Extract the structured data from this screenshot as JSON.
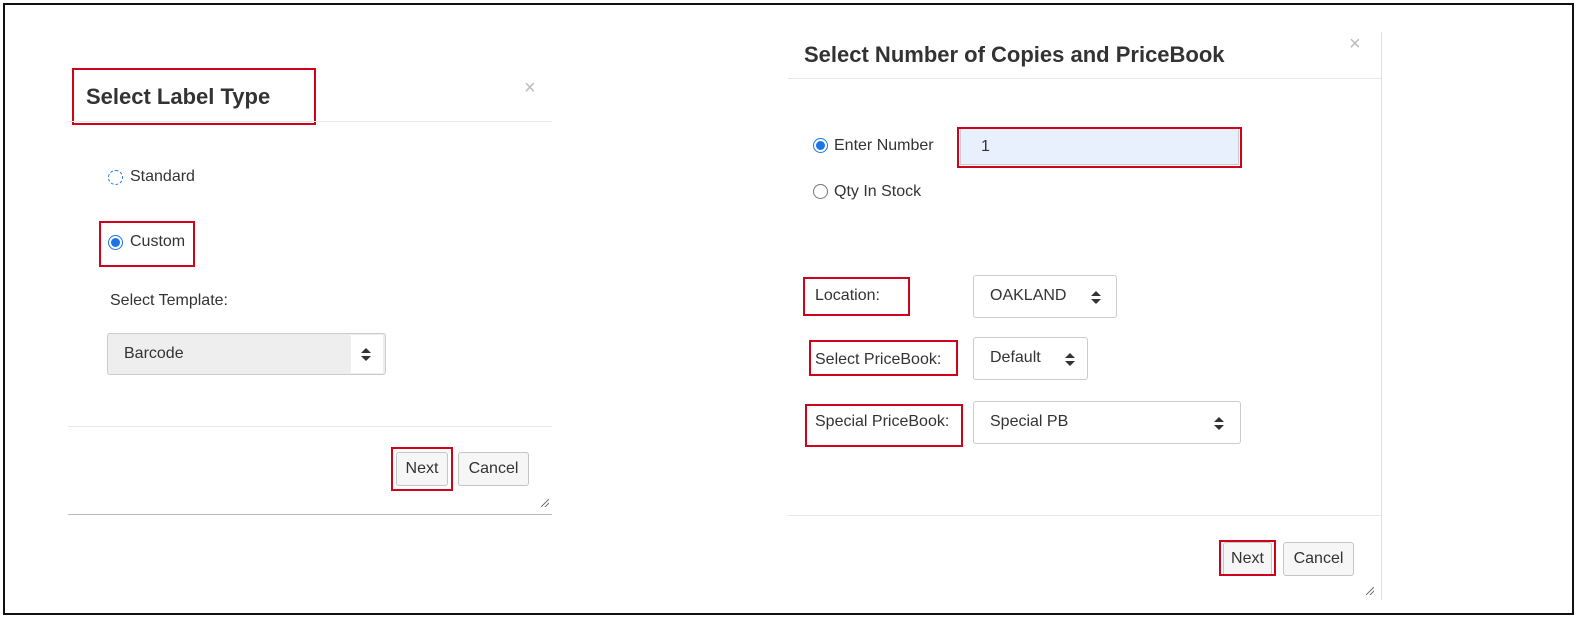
{
  "left_dialog": {
    "title": "Select Label Type",
    "close_glyph": "×",
    "options": [
      {
        "label": "Standard",
        "selected": false
      },
      {
        "label": "Custom",
        "selected": true
      }
    ],
    "template_label": "Select Template:",
    "template_value": "Barcode",
    "next_label": "Next",
    "cancel_label": "Cancel"
  },
  "right_dialog": {
    "title": "Select Number of Copies and PriceBook",
    "close_glyph": "×",
    "options": [
      {
        "label": "Enter Number",
        "selected": true
      },
      {
        "label": "Qty In Stock",
        "selected": false
      }
    ],
    "number_value": "1",
    "location_label": "Location:",
    "location_value": "OAKLAND",
    "pricebook_label": "Select PriceBook:",
    "pricebook_value": "Default",
    "special_label": "Special PriceBook:",
    "special_value": "Special PB",
    "next_label": "Next",
    "cancel_label": "Cancel"
  },
  "colors": {
    "highlight": "#d0021b",
    "radio_selected": "#1a73e8",
    "input_bg": "#e8f0fe"
  }
}
